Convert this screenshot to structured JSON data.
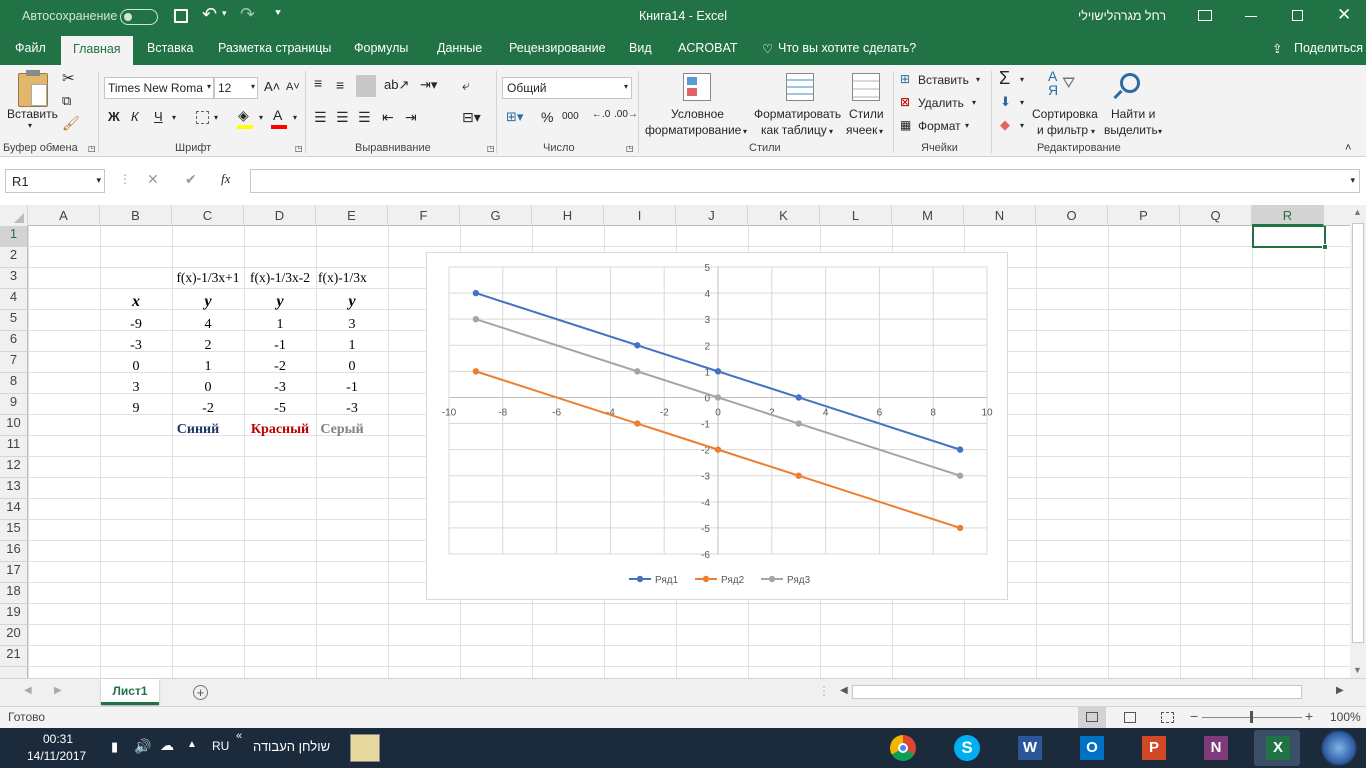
{
  "titlebar": {
    "autosave_label": "Автосохранение",
    "doc_title": "Книга14  -  Excel",
    "user_name": "רחל מגרהלישוילי",
    "bg": "#217346"
  },
  "ribbon_tabs": [
    "Файл",
    "Главная",
    "Вставка",
    "Разметка страницы",
    "Формулы",
    "Данные",
    "Рецензирование",
    "Вид",
    "ACROBAT",
    "Что вы хотите сделать?"
  ],
  "share_label": "Поделиться",
  "ribbon": {
    "paste": "Вставить",
    "font_name": "Times New Roma",
    "font_size": "12",
    "bold": "Ж",
    "italic": "К",
    "underline": "Ч",
    "number_format": "Общий",
    "cond_format_1": "Условное",
    "cond_format_2": "форматирование",
    "format_table_1": "Форматировать",
    "format_table_2": "как таблицу",
    "cell_styles_1": "Стили",
    "cell_styles_2": "ячеек",
    "insert": "Вставить",
    "delete": "Удалить",
    "format": "Формат",
    "sort_1": "Сортировка",
    "sort_2": "и фильтр",
    "find_1": "Найти и",
    "find_2": "выделить",
    "groups": {
      "clipboard": "Буфер обмена",
      "font": "Шрифт",
      "alignment": "Выравнивание",
      "number": "Число",
      "styles": "Стили",
      "cells": "Ячейки",
      "editing": "Редактирование"
    }
  },
  "formula_bar": {
    "name_box": "R1",
    "fx": "fx",
    "formula": ""
  },
  "columns": [
    "A",
    "B",
    "C",
    "D",
    "E",
    "F",
    "G",
    "H",
    "I",
    "J",
    "K",
    "L",
    "M",
    "N",
    "O",
    "P",
    "Q",
    "R"
  ],
  "rows": [
    "1",
    "2",
    "3",
    "4",
    "5",
    "6",
    "7",
    "8",
    "9",
    "10",
    "11",
    "12",
    "13",
    "14",
    "15",
    "16",
    "17",
    "18",
    "19",
    "20",
    "21"
  ],
  "sheet": {
    "c3": "f(x)-1/3x+1",
    "d3": "f(x)-1/3x-2",
    "e3": "f(x)-1/3x",
    "b4": "x",
    "c4": "y",
    "d4": "y",
    "e4": "y",
    "data_rows": [
      [
        "-9",
        "4",
        "1",
        "3"
      ],
      [
        "-3",
        "2",
        "-1",
        "1"
      ],
      [
        "0",
        "1",
        "-2",
        "0"
      ],
      [
        "3",
        "0",
        "-3",
        "-1"
      ],
      [
        "9",
        "-2",
        "-5",
        "-3"
      ]
    ],
    "c10": "Синий",
    "d10": "Красный",
    "e10": "Серый",
    "c10_color": "#1f3864",
    "d10_color": "#c00000",
    "e10_color": "#808080"
  },
  "chart_data": {
    "type": "line",
    "title": "",
    "x": [
      -9,
      -3,
      0,
      3,
      9
    ],
    "series": [
      {
        "name": "Ряд1",
        "values": [
          4,
          2,
          1,
          0,
          -2
        ],
        "color": "#4472c4"
      },
      {
        "name": "Ряд2",
        "values": [
          1,
          -1,
          -2,
          -3,
          -5
        ],
        "color": "#ed7d31"
      },
      {
        "name": "Ряд3",
        "values": [
          3,
          1,
          0,
          -1,
          -3
        ],
        "color": "#a5a5a5"
      }
    ],
    "xlim": [
      -10,
      10
    ],
    "ylim": [
      -6,
      5
    ],
    "xticks": [
      -10,
      -8,
      -6,
      -4,
      -2,
      0,
      2,
      4,
      6,
      8,
      10
    ],
    "yticks": [
      5,
      4,
      3,
      2,
      1,
      0,
      -1,
      -2,
      -3,
      -4,
      -5,
      -6
    ],
    "grid": true,
    "legend": "bottom"
  },
  "sheet_tab": "Лист1",
  "status": {
    "ready": "Готово",
    "zoom": "100%"
  },
  "taskbar": {
    "time": "00:31",
    "date": "14/11/2017",
    "lang": "RU",
    "desktop": "שולחן העבודה"
  }
}
